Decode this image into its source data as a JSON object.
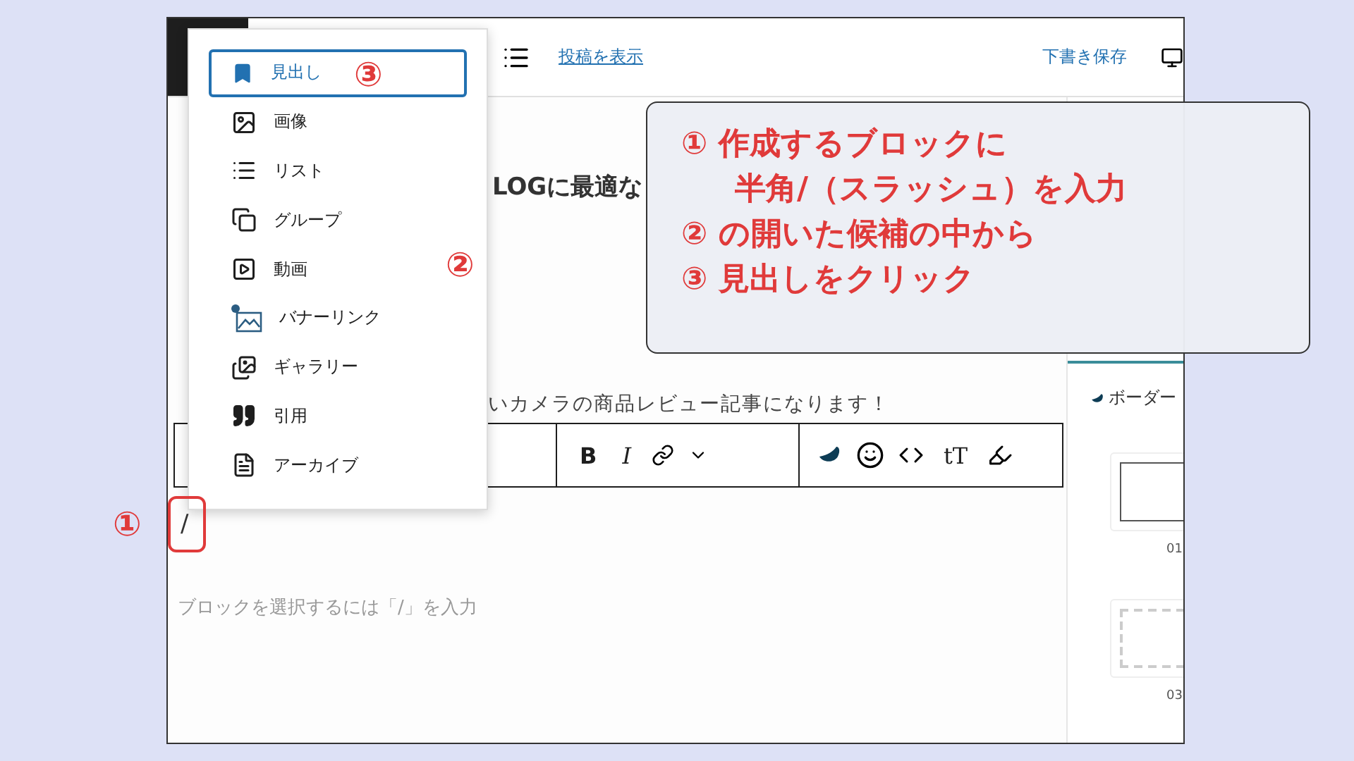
{
  "topbar": {
    "view_post_link": "投稿を表示",
    "save_draft": "下書き保存"
  },
  "editor": {
    "heading_visible": "LOGに最適な",
    "paragraph_visible": "いカメラの商品レビュー記事になります！",
    "toolbar": {
      "bold": "B",
      "italic": "I",
      "font_size": "tT"
    },
    "slash_input": "/",
    "placeholder": "ブロックを選択するには「/」を入力"
  },
  "block_menu": {
    "items": [
      {
        "label": "見出し",
        "selected": true
      },
      {
        "label": "画像",
        "selected": false
      },
      {
        "label": "リスト",
        "selected": false
      },
      {
        "label": "グループ",
        "selected": false
      },
      {
        "label": "動画",
        "selected": false
      },
      {
        "label": "バナーリンク",
        "selected": false
      },
      {
        "label": "ギャラリー",
        "selected": false
      },
      {
        "label": "引用",
        "selected": false
      },
      {
        "label": "アーカイブ",
        "selected": false
      }
    ]
  },
  "sidebar": {
    "section_label": "ボーダー",
    "thumbnails": [
      "01",
      "03"
    ]
  },
  "annotations": {
    "step_markers": [
      "①",
      "②",
      "③"
    ],
    "callout_lines": [
      "① 作成するブロックに",
      "半角/（スラッシュ）を入力",
      "② の開いた候補の中から",
      "③ 見出しをクリック"
    ]
  }
}
